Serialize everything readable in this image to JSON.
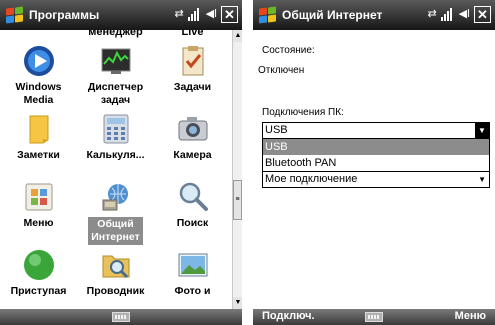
{
  "left_screen": {
    "title": "Программы",
    "partial_row": [
      "менеджер",
      "Live"
    ],
    "apps": [
      {
        "label": "Windows\nMedia"
      },
      {
        "label": "Диспетчер\nзадач"
      },
      {
        "label": "Задачи"
      },
      {
        "label": "Заметки"
      },
      {
        "label": "Калькуля..."
      },
      {
        "label": "Камера"
      },
      {
        "label": "Меню"
      },
      {
        "label": "Общий\nИнтернет"
      },
      {
        "label": "Поиск"
      },
      {
        "label": "Приступая"
      },
      {
        "label": "Проводник"
      },
      {
        "label": "Фото и"
      }
    ],
    "selected_index": 7
  },
  "right_screen": {
    "title": "Общий Интернет",
    "status_label": "Состояние:",
    "status_value": "Отключен",
    "pc_connection_label": "Подключения ПК:",
    "pc_connection_value": "USB",
    "dropdown_options": [
      "USB",
      "Bluetooth PAN"
    ],
    "dropdown_selected": "USB",
    "network_connection_value": "Мое подключение",
    "softkey_left": "Подключ.",
    "softkey_right": "Меню"
  },
  "colors": {
    "titlebar": "#2a2a2a",
    "selection": "#8c8c8c",
    "background": "#ffffff"
  }
}
